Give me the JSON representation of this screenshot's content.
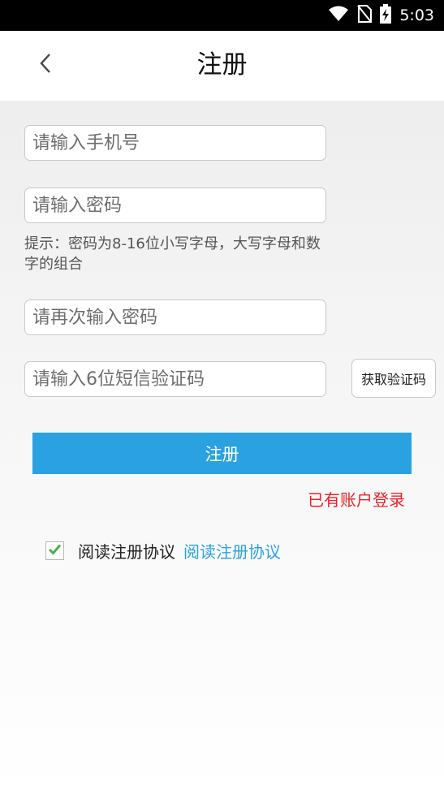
{
  "status_bar": {
    "time": "5:03",
    "icons": [
      "wifi-icon",
      "no-sim-icon",
      "battery-charging-icon"
    ]
  },
  "header": {
    "title": "注册",
    "back_icon": "chevron-left-icon"
  },
  "form": {
    "phone_placeholder": "请输入手机号",
    "password_placeholder": "请输入密码",
    "password_hint": "提示：密码为8-16位小写字母，大写字母和数字的组合",
    "confirm_password_placeholder": "请再次输入密码",
    "sms_code_placeholder": "请输入6位短信验证码",
    "get_code_label": "获取验证码",
    "submit_label": "注册",
    "login_link": "已有账户登录"
  },
  "agreement": {
    "checked": true,
    "text": "阅读注册协议",
    "link": "阅读注册协议"
  },
  "colors": {
    "accent": "#2aa2e1",
    "login_link": "#e8232b",
    "checkmark": "#4caf50"
  }
}
